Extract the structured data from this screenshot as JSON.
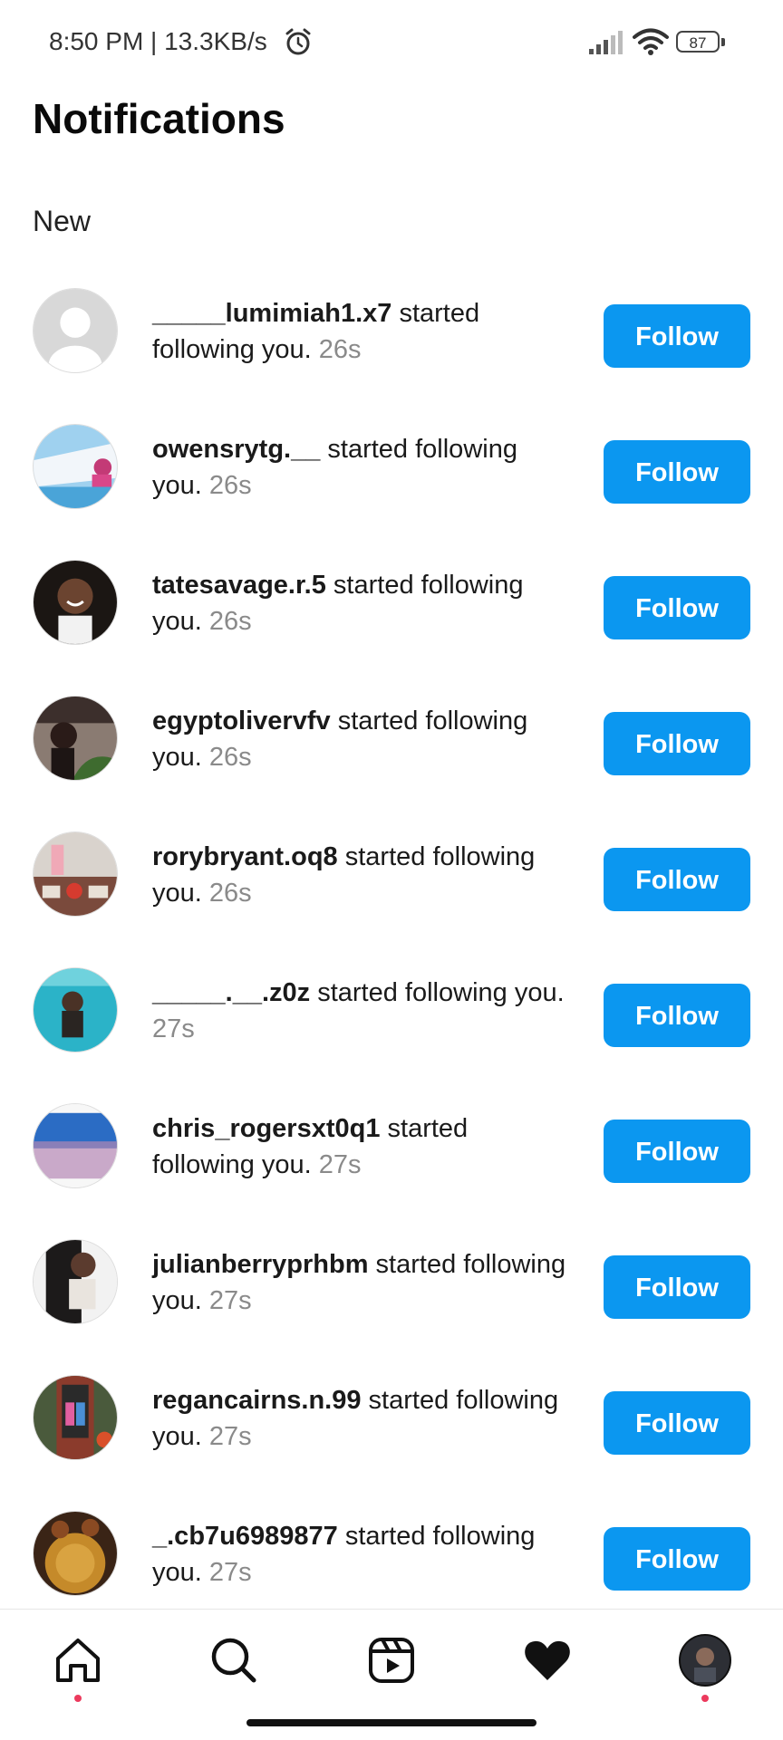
{
  "status_bar": {
    "time_speed": "8:50 PM | 13.3KB/s",
    "battery": "87"
  },
  "header": {
    "title": "Notifications"
  },
  "section": {
    "title": "New"
  },
  "notifications": [
    {
      "username": "_____lumimiah1.x7",
      "action": " started following you. ",
      "time": "26s",
      "button": "Follow"
    },
    {
      "username": "owensrytg.__",
      "action": " started following you. ",
      "time": "26s",
      "button": "Follow"
    },
    {
      "username": "tatesavage.r.5",
      "action": " started following you. ",
      "time": "26s",
      "button": "Follow"
    },
    {
      "username": "egyptolivervfv",
      "action": " started following you. ",
      "time": "26s",
      "button": "Follow"
    },
    {
      "username": "rorybryant.oq8",
      "action": " started following you. ",
      "time": "26s",
      "button": "Follow"
    },
    {
      "username": "_____.__.z0z",
      "action": " started following you. ",
      "time": "27s",
      "button": "Follow"
    },
    {
      "username": "chris_rogersxt0q1",
      "action": " started following you. ",
      "time": "27s",
      "button": "Follow"
    },
    {
      "username": "julianberryprhbm",
      "action": " started following you. ",
      "time": "27s",
      "button": "Follow"
    },
    {
      "username": "regancairns.n.99",
      "action": " started following you. ",
      "time": "27s",
      "button": "Follow"
    },
    {
      "username": "_.cb7u6989877",
      "action": " started following you. ",
      "time": "27s",
      "button": "Follow"
    }
  ],
  "colors": {
    "follow_button": "#0b97f0",
    "timestamp": "#8a8a8a",
    "notification_dot": "#ec3a5d"
  },
  "bottom_nav": {
    "icons": [
      "home-icon",
      "search-icon",
      "reels-icon",
      "heart-icon",
      "profile-avatar"
    ]
  }
}
